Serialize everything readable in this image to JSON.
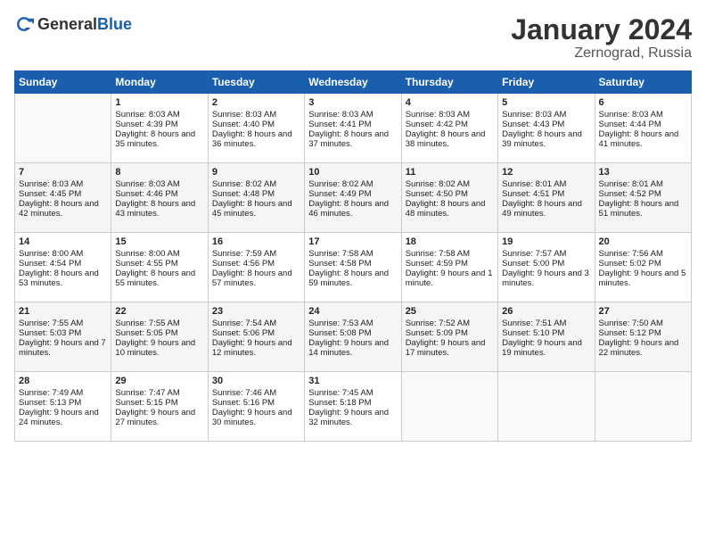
{
  "logo": {
    "general": "General",
    "blue": "Blue"
  },
  "header": {
    "title": "January 2024",
    "subtitle": "Zernograd, Russia"
  },
  "days_of_week": [
    "Sunday",
    "Monday",
    "Tuesday",
    "Wednesday",
    "Thursday",
    "Friday",
    "Saturday"
  ],
  "weeks": [
    [
      {
        "day": "",
        "sunrise": "",
        "sunset": "",
        "daylight": ""
      },
      {
        "day": "1",
        "sunrise": "Sunrise: 8:03 AM",
        "sunset": "Sunset: 4:39 PM",
        "daylight": "Daylight: 8 hours and 35 minutes."
      },
      {
        "day": "2",
        "sunrise": "Sunrise: 8:03 AM",
        "sunset": "Sunset: 4:40 PM",
        "daylight": "Daylight: 8 hours and 36 minutes."
      },
      {
        "day": "3",
        "sunrise": "Sunrise: 8:03 AM",
        "sunset": "Sunset: 4:41 PM",
        "daylight": "Daylight: 8 hours and 37 minutes."
      },
      {
        "day": "4",
        "sunrise": "Sunrise: 8:03 AM",
        "sunset": "Sunset: 4:42 PM",
        "daylight": "Daylight: 8 hours and 38 minutes."
      },
      {
        "day": "5",
        "sunrise": "Sunrise: 8:03 AM",
        "sunset": "Sunset: 4:43 PM",
        "daylight": "Daylight: 8 hours and 39 minutes."
      },
      {
        "day": "6",
        "sunrise": "Sunrise: 8:03 AM",
        "sunset": "Sunset: 4:44 PM",
        "daylight": "Daylight: 8 hours and 41 minutes."
      }
    ],
    [
      {
        "day": "7",
        "sunrise": "Sunrise: 8:03 AM",
        "sunset": "Sunset: 4:45 PM",
        "daylight": "Daylight: 8 hours and 42 minutes."
      },
      {
        "day": "8",
        "sunrise": "Sunrise: 8:03 AM",
        "sunset": "Sunset: 4:46 PM",
        "daylight": "Daylight: 8 hours and 43 minutes."
      },
      {
        "day": "9",
        "sunrise": "Sunrise: 8:02 AM",
        "sunset": "Sunset: 4:48 PM",
        "daylight": "Daylight: 8 hours and 45 minutes."
      },
      {
        "day": "10",
        "sunrise": "Sunrise: 8:02 AM",
        "sunset": "Sunset: 4:49 PM",
        "daylight": "Daylight: 8 hours and 46 minutes."
      },
      {
        "day": "11",
        "sunrise": "Sunrise: 8:02 AM",
        "sunset": "Sunset: 4:50 PM",
        "daylight": "Daylight: 8 hours and 48 minutes."
      },
      {
        "day": "12",
        "sunrise": "Sunrise: 8:01 AM",
        "sunset": "Sunset: 4:51 PM",
        "daylight": "Daylight: 8 hours and 49 minutes."
      },
      {
        "day": "13",
        "sunrise": "Sunrise: 8:01 AM",
        "sunset": "Sunset: 4:52 PM",
        "daylight": "Daylight: 8 hours and 51 minutes."
      }
    ],
    [
      {
        "day": "14",
        "sunrise": "Sunrise: 8:00 AM",
        "sunset": "Sunset: 4:54 PM",
        "daylight": "Daylight: 8 hours and 53 minutes."
      },
      {
        "day": "15",
        "sunrise": "Sunrise: 8:00 AM",
        "sunset": "Sunset: 4:55 PM",
        "daylight": "Daylight: 8 hours and 55 minutes."
      },
      {
        "day": "16",
        "sunrise": "Sunrise: 7:59 AM",
        "sunset": "Sunset: 4:56 PM",
        "daylight": "Daylight: 8 hours and 57 minutes."
      },
      {
        "day": "17",
        "sunrise": "Sunrise: 7:58 AM",
        "sunset": "Sunset: 4:58 PM",
        "daylight": "Daylight: 8 hours and 59 minutes."
      },
      {
        "day": "18",
        "sunrise": "Sunrise: 7:58 AM",
        "sunset": "Sunset: 4:59 PM",
        "daylight": "Daylight: 9 hours and 1 minute."
      },
      {
        "day": "19",
        "sunrise": "Sunrise: 7:57 AM",
        "sunset": "Sunset: 5:00 PM",
        "daylight": "Daylight: 9 hours and 3 minutes."
      },
      {
        "day": "20",
        "sunrise": "Sunrise: 7:56 AM",
        "sunset": "Sunset: 5:02 PM",
        "daylight": "Daylight: 9 hours and 5 minutes."
      }
    ],
    [
      {
        "day": "21",
        "sunrise": "Sunrise: 7:55 AM",
        "sunset": "Sunset: 5:03 PM",
        "daylight": "Daylight: 9 hours and 7 minutes."
      },
      {
        "day": "22",
        "sunrise": "Sunrise: 7:55 AM",
        "sunset": "Sunset: 5:05 PM",
        "daylight": "Daylight: 9 hours and 10 minutes."
      },
      {
        "day": "23",
        "sunrise": "Sunrise: 7:54 AM",
        "sunset": "Sunset: 5:06 PM",
        "daylight": "Daylight: 9 hours and 12 minutes."
      },
      {
        "day": "24",
        "sunrise": "Sunrise: 7:53 AM",
        "sunset": "Sunset: 5:08 PM",
        "daylight": "Daylight: 9 hours and 14 minutes."
      },
      {
        "day": "25",
        "sunrise": "Sunrise: 7:52 AM",
        "sunset": "Sunset: 5:09 PM",
        "daylight": "Daylight: 9 hours and 17 minutes."
      },
      {
        "day": "26",
        "sunrise": "Sunrise: 7:51 AM",
        "sunset": "Sunset: 5:10 PM",
        "daylight": "Daylight: 9 hours and 19 minutes."
      },
      {
        "day": "27",
        "sunrise": "Sunrise: 7:50 AM",
        "sunset": "Sunset: 5:12 PM",
        "daylight": "Daylight: 9 hours and 22 minutes."
      }
    ],
    [
      {
        "day": "28",
        "sunrise": "Sunrise: 7:49 AM",
        "sunset": "Sunset: 5:13 PM",
        "daylight": "Daylight: 9 hours and 24 minutes."
      },
      {
        "day": "29",
        "sunrise": "Sunrise: 7:47 AM",
        "sunset": "Sunset: 5:15 PM",
        "daylight": "Daylight: 9 hours and 27 minutes."
      },
      {
        "day": "30",
        "sunrise": "Sunrise: 7:46 AM",
        "sunset": "Sunset: 5:16 PM",
        "daylight": "Daylight: 9 hours and 30 minutes."
      },
      {
        "day": "31",
        "sunrise": "Sunrise: 7:45 AM",
        "sunset": "Sunset: 5:18 PM",
        "daylight": "Daylight: 9 hours and 32 minutes."
      },
      {
        "day": "",
        "sunrise": "",
        "sunset": "",
        "daylight": ""
      },
      {
        "day": "",
        "sunrise": "",
        "sunset": "",
        "daylight": ""
      },
      {
        "day": "",
        "sunrise": "",
        "sunset": "",
        "daylight": ""
      }
    ]
  ]
}
